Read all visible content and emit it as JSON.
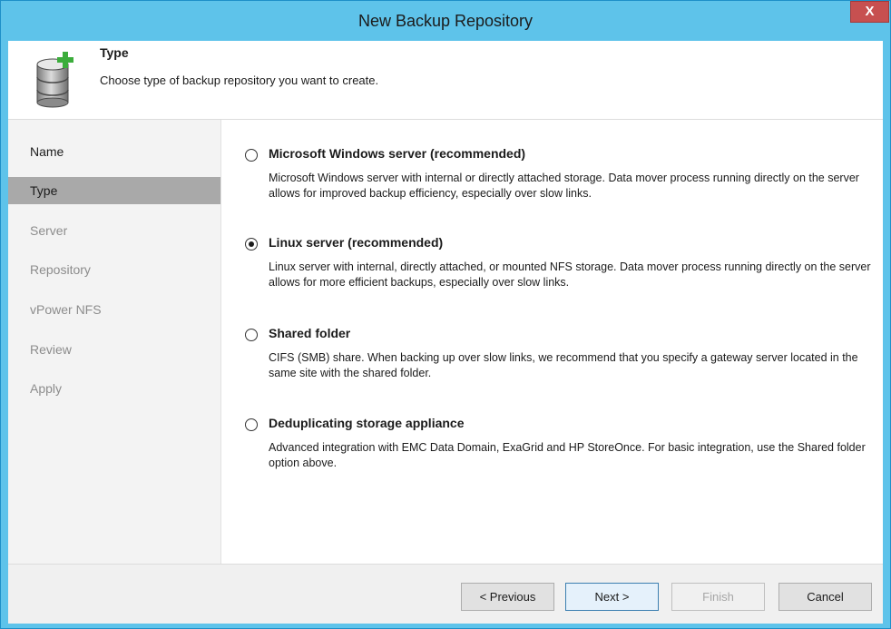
{
  "window": {
    "title": "New Backup Repository",
    "close_label": "X"
  },
  "header": {
    "icon": "database-add-icon",
    "title": "Type",
    "description": "Choose type of backup repository you want to create."
  },
  "sidebar": {
    "items": [
      {
        "label": "Name",
        "state": "done"
      },
      {
        "label": "Type",
        "state": "current"
      },
      {
        "label": "Server",
        "state": "pending"
      },
      {
        "label": "Repository",
        "state": "pending"
      },
      {
        "label": "vPower NFS",
        "state": "pending"
      },
      {
        "label": "Review",
        "state": "pending"
      },
      {
        "label": "Apply",
        "state": "pending"
      }
    ]
  },
  "options": [
    {
      "label": "Microsoft Windows server (recommended)",
      "description": "Microsoft Windows server with internal or directly attached storage. Data mover process running directly on the server allows for improved backup efficiency, especially over slow links.",
      "checked": false
    },
    {
      "label": "Linux server (recommended)",
      "description": "Linux server with internal, directly attached, or mounted NFS storage. Data mover process running directly on the server allows for more efficient backups, especially over slow links.",
      "checked": true
    },
    {
      "label": "Shared folder",
      "description": "CIFS (SMB) share. When backing up over slow links, we recommend that you specify a gateway server located in the same site with the shared folder.",
      "checked": false
    },
    {
      "label": "Deduplicating storage appliance",
      "description": "Advanced integration with EMC Data Domain, ExaGrid and HP StoreOnce. For basic integration, use the Shared folder option above.",
      "checked": false
    }
  ],
  "footer": {
    "previous_label": "< Previous",
    "next_label": "Next >",
    "finish_label": "Finish",
    "cancel_label": "Cancel"
  },
  "colors": {
    "titlebar": "#5ec3ea",
    "close_button": "#c75050",
    "selected_nav": "#a9a9a9"
  }
}
